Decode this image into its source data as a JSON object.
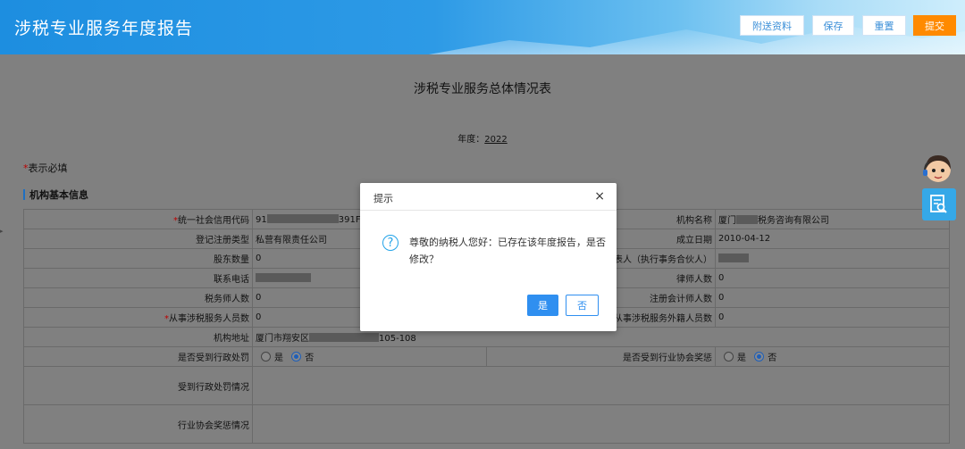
{
  "header": {
    "title": "涉税专业服务年度报告",
    "buttons": {
      "attach": "附送资料",
      "save": "保存",
      "reset": "重置",
      "submit": "提交"
    }
  },
  "doc": {
    "title": "涉税专业服务总体情况表",
    "year_label": "年度：",
    "year_value": "2022",
    "required_star": "*",
    "required_note": "表示必填",
    "section_title": "机构基本信息"
  },
  "form": {
    "credit_code_star": "*",
    "credit_code_label": "统一社会信用代码",
    "credit_code_prefix": "91",
    "credit_code_suffix": "391F",
    "org_name_label": "机构名称",
    "org_name_prefix": "厦门",
    "org_name_suffix": "税务咨询有限公司",
    "reg_type_label": "登记注册类型",
    "reg_type_value": "私营有限责任公司",
    "founded_label": "成立日期",
    "founded_value": "2010-04-12",
    "shareholders_label": "股东数量",
    "shareholders_value": "0",
    "legal_rep_label": "法定代表人（执行事务合伙人）",
    "phone_label": "联系电话",
    "lawyers_label": "律师人数",
    "lawyers_value": "0",
    "tax_agents_label": "税务师人数",
    "tax_agents_value": "0",
    "cpa_label": "注册会计师人数",
    "cpa_value": "0",
    "staff_star": "*",
    "staff_label": "从事涉税服务人员数",
    "staff_value": "0",
    "foreign_staff_label": "从事涉税服务外籍人员数",
    "foreign_staff_value": "0",
    "address_label": "机构地址",
    "address_prefix": "厦门市翔安区",
    "address_suffix": "105-108",
    "admin_penalty_label": "是否受到行政处罚",
    "association_award_label": "是否受到行业协会奖惩",
    "radio_yes": "是",
    "radio_no": "否",
    "admin_penalty_selected": "否",
    "association_award_selected": "否",
    "penalty_detail_label": "受到行政处罚情况",
    "award_detail_label": "行业协会奖惩情况"
  },
  "dialog": {
    "title": "提示",
    "close": "×",
    "message": "尊敬的纳税人您好：已存在该年度报告，是否修改？",
    "yes": "是",
    "no": "否"
  },
  "icons": {
    "dialog": "question-circle-icon",
    "side": "document-search-icon",
    "assistant": "assistant-avatar-icon"
  },
  "colors": {
    "accent": "#2f8ff0",
    "submit": "#ff8a00",
    "header": "#1d8ee0"
  }
}
